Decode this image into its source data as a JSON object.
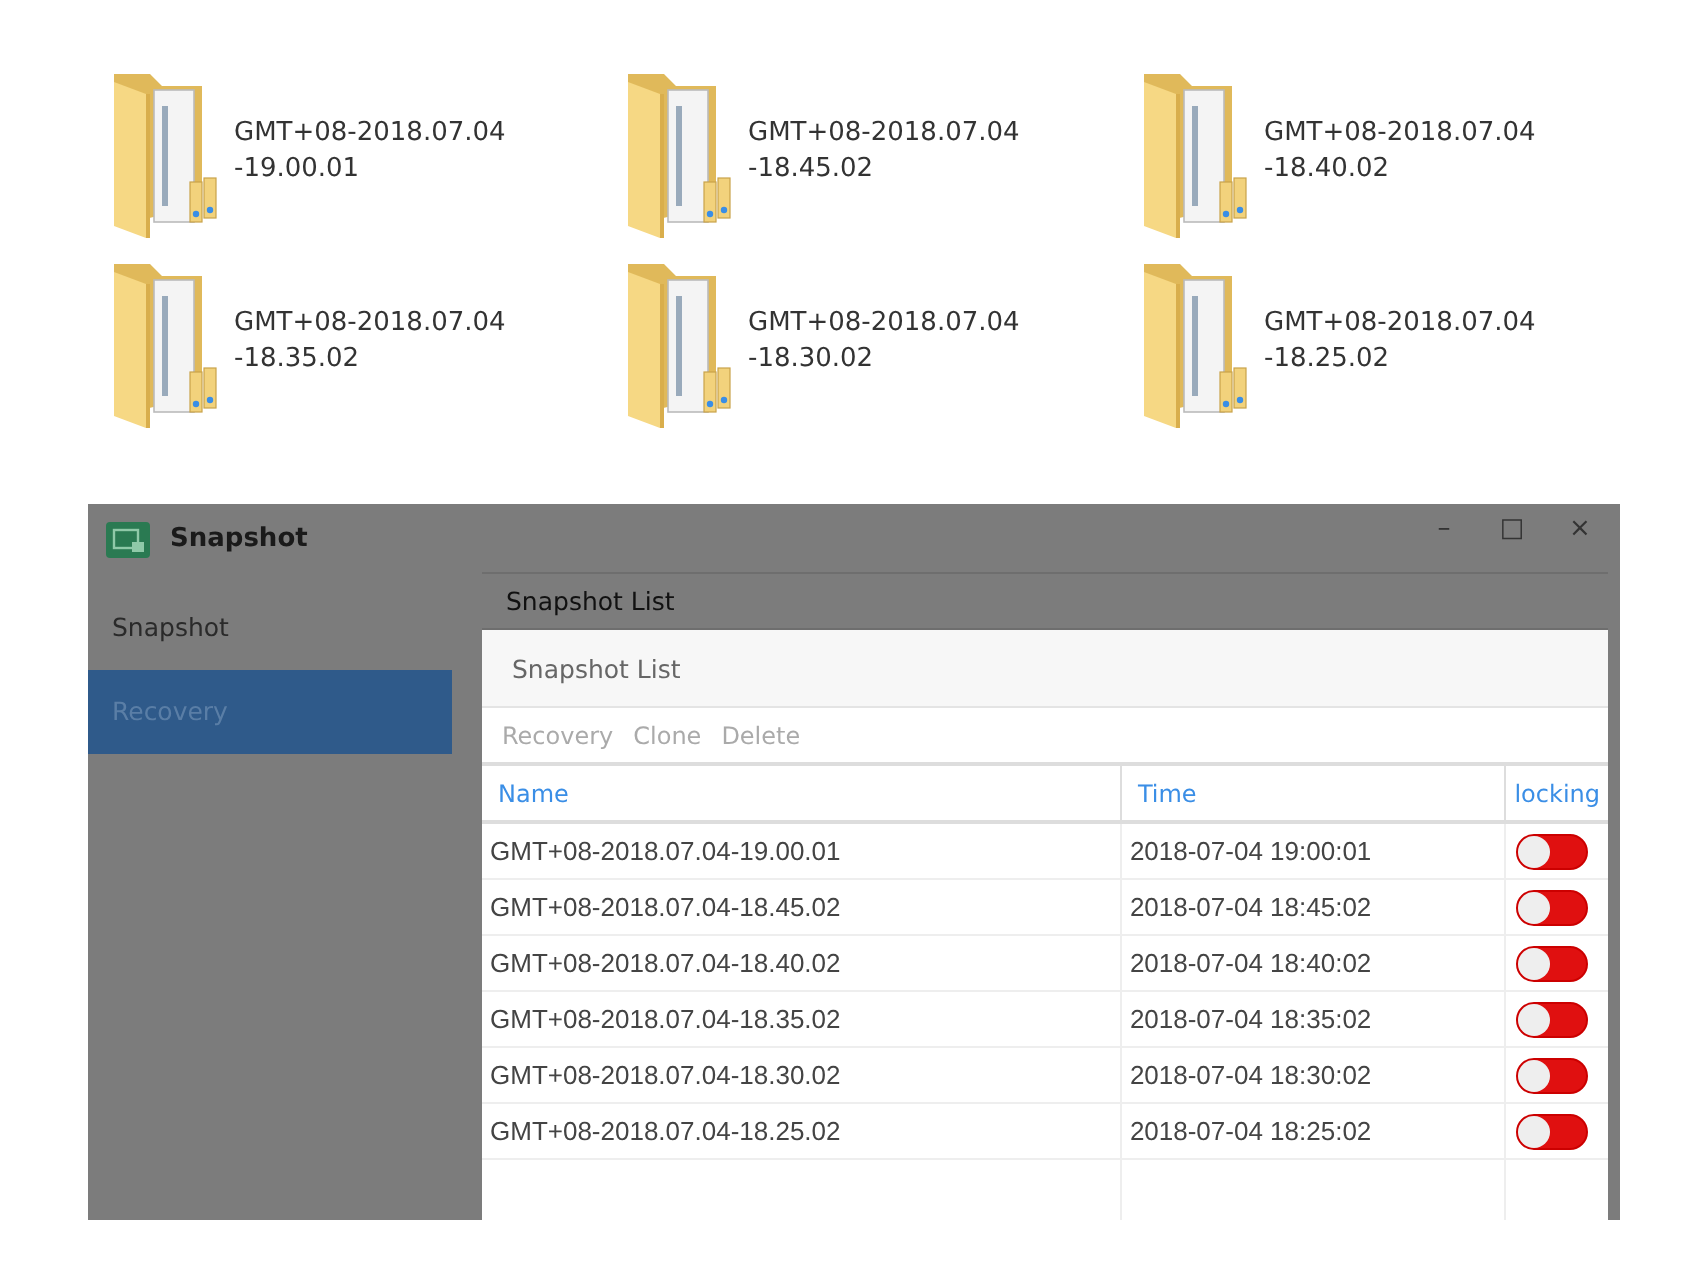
{
  "folders": [
    {
      "line1": "GMT+08-2018.07.04",
      "line2": "-19.00.01"
    },
    {
      "line1": "GMT+08-2018.07.04",
      "line2": "-18.45.02"
    },
    {
      "line1": "GMT+08-2018.07.04",
      "line2": "-18.40.02"
    },
    {
      "line1": "GMT+08-2018.07.04",
      "line2": "-18.35.02"
    },
    {
      "line1": "GMT+08-2018.07.04",
      "line2": "-18.30.02"
    },
    {
      "line1": "GMT+08-2018.07.04",
      "line2": "-18.25.02"
    }
  ],
  "window": {
    "title": "Snapshot",
    "controls": [
      "–",
      "□",
      "×"
    ]
  },
  "sidebar": {
    "items": [
      {
        "label": "Snapshot",
        "selected": false
      },
      {
        "label": "Recovery",
        "selected": true
      }
    ]
  },
  "content_tab": "Snapshot List",
  "panel": {
    "title": "Snapshot List",
    "toolbar": [
      "Recovery",
      "Clone",
      "Delete"
    ],
    "table": {
      "columns": [
        "Name",
        "Time",
        "locking"
      ],
      "rows": [
        {
          "name": "GMT+08-2018.07.04-19.00.01",
          "time": "2018-07-04 19:00:01",
          "on": false
        },
        {
          "name": "GMT+08-2018.07.04-18.45.02",
          "time": "2018-07-04 18:45:02",
          "on": false
        },
        {
          "name": "GMT+08-2018.07.04-18.40.02",
          "time": "2018-07-04 18:40:02",
          "on": false
        },
        {
          "name": "GMT+08-2018.07.04-18.35.02",
          "time": "2018-07-04 18:35:02",
          "on": false
        },
        {
          "name": "GMT+08-2018.07.04-18.30.02",
          "time": "2018-07-04 18:30:02",
          "on": false
        },
        {
          "name": "GMT+08-2018.07.04-18.25.02",
          "time": "2018-07-04 18:25:02",
          "on": false
        }
      ]
    }
  }
}
